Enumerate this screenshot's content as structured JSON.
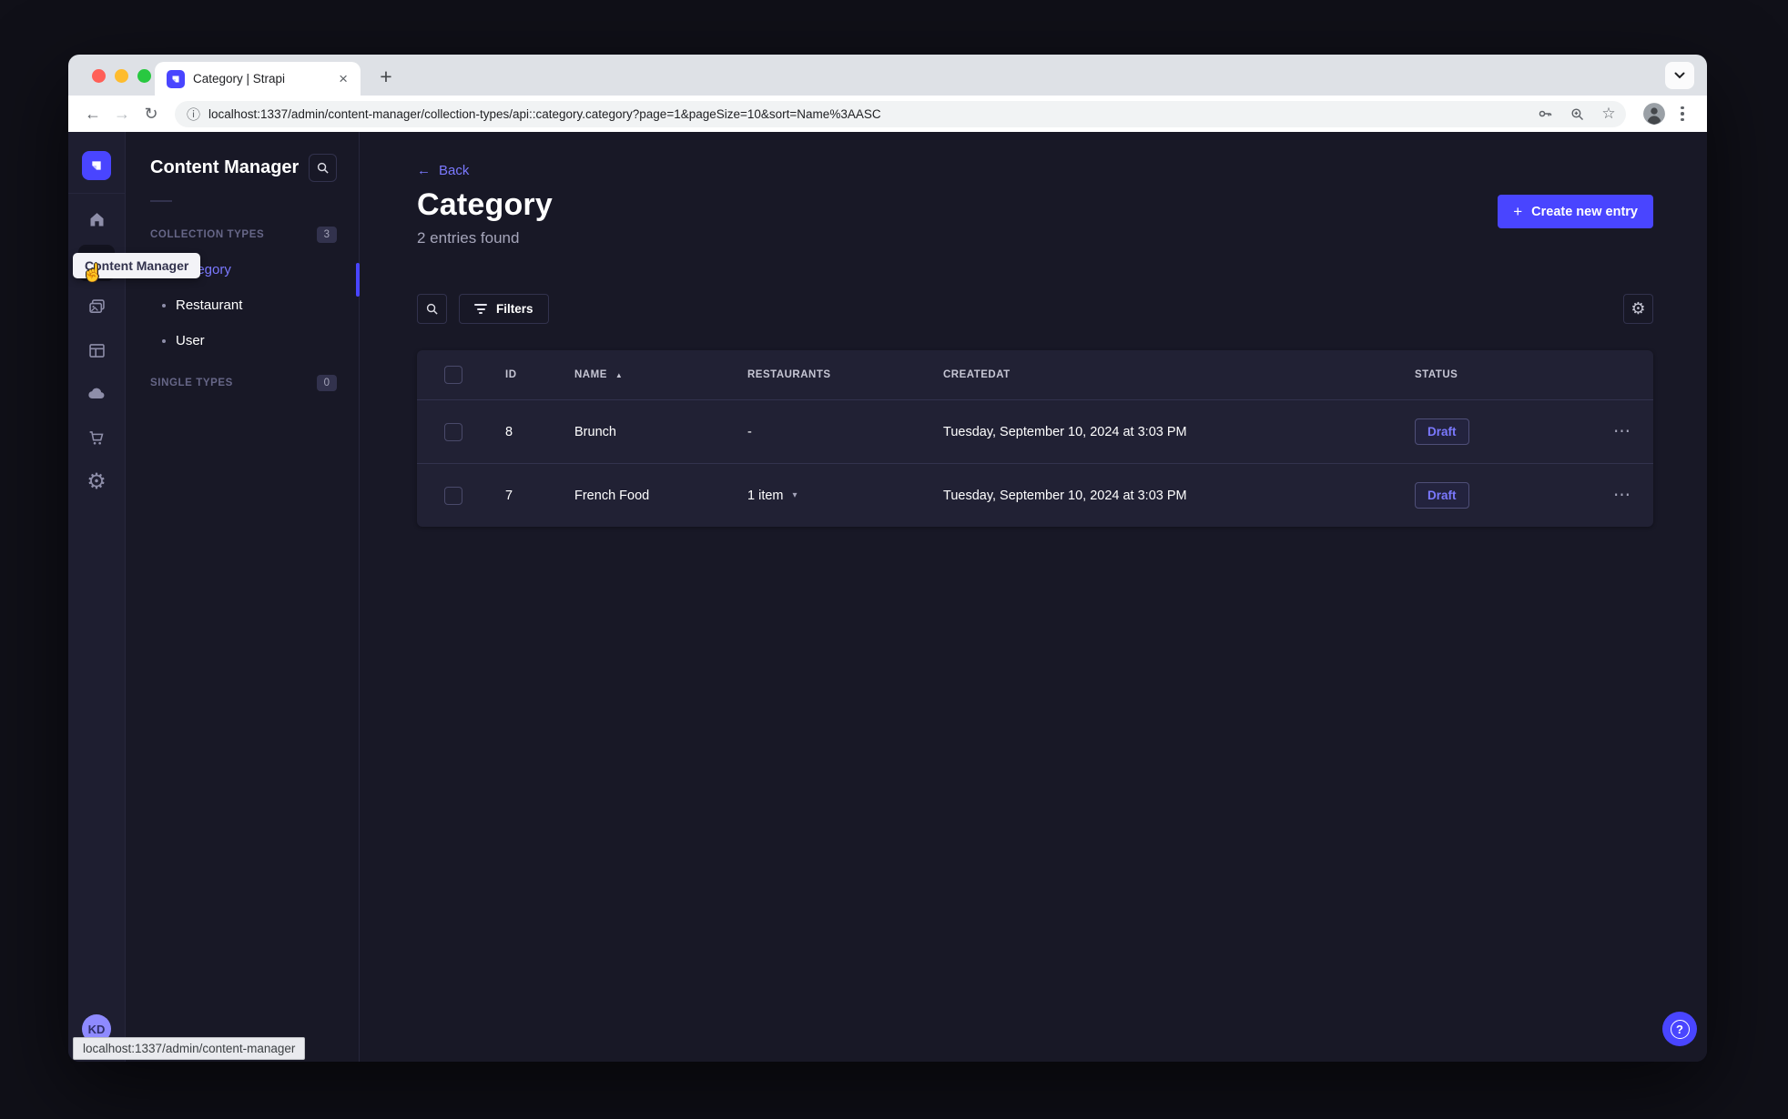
{
  "browser": {
    "tab_title": "Category | Strapi",
    "close_tab_glyph": "×",
    "new_tab_glyph": "+",
    "back_glyph": "←",
    "forward_glyph": "→",
    "reload_glyph": "↻",
    "url_info_glyph": "ⓘ",
    "url": "localhost:1337/admin/content-manager/collection-types/api::category.category?page=1&pageSize=10&sort=Name%3AASC",
    "bookmark_glyph": "☆",
    "status_tooltip": "localhost:1337/admin/content-manager"
  },
  "nav": {
    "tooltip": "Content Manager",
    "avatar_initials": "KD",
    "settings_glyph": "⚙",
    "cursor_glyph": "☝",
    "icons": [
      "strapi-logo",
      "home",
      "content-manager",
      "media-library",
      "content-type-builder",
      "deploy-cloud",
      "marketplace",
      "settings"
    ]
  },
  "subnav": {
    "title": "Content Manager",
    "collection_types_label": "COLLECTION TYPES",
    "collection_types_count": "3",
    "items": [
      {
        "label": "Category",
        "active": true
      },
      {
        "label": "Restaurant",
        "active": false
      },
      {
        "label": "User",
        "active": false
      }
    ],
    "single_types_label": "SINGLE TYPES",
    "single_types_count": "0"
  },
  "main": {
    "back_label": "Back",
    "back_glyph": "←",
    "title": "Category",
    "subtitle": "2 entries found",
    "create_button": "Create new entry",
    "create_plus_glyph": "+",
    "filters_label": "Filters",
    "view_settings_glyph": "⚙",
    "table": {
      "headers": {
        "id": "ID",
        "name": "NAME",
        "restaurants": "RESTAURANTS",
        "createdat": "CREATEDAT",
        "status": "STATUS"
      },
      "sort_glyph": "▲",
      "rows": [
        {
          "id": "8",
          "name": "Brunch",
          "restaurants": "-",
          "createdat": "Tuesday, September 10, 2024 at 3:03 PM",
          "status": "Draft"
        },
        {
          "id": "7",
          "name": "French Food",
          "restaurants": "1 item",
          "restaurants_caret": "▾",
          "createdat": "Tuesday, September 10, 2024 at 3:03 PM",
          "status": "Draft"
        }
      ],
      "row_menu_glyph": "⋯"
    },
    "help_glyph": "?"
  },
  "colors": {
    "primary": "#4945ff",
    "primary_light": "#7b79ff",
    "app_bg": "#181826",
    "card_bg": "#212134",
    "border": "#32324d",
    "text_muted": "#a5a5ba"
  }
}
